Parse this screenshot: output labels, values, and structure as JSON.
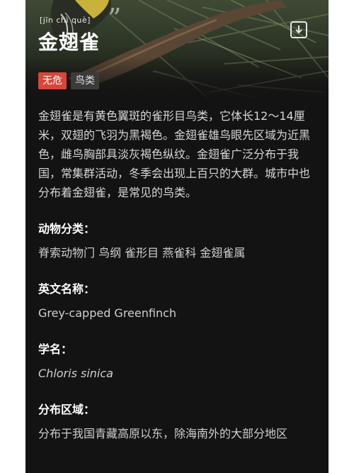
{
  "header": {
    "pinyin": "[jīn chì què]",
    "title": "金翅雀",
    "save_icon": "download-icon"
  },
  "tags": {
    "status": "无危",
    "category": "鸟类"
  },
  "description": "金翅雀是有黄色翼斑的雀形目鸟类，它体长12～14厘米，双翅的飞羽为黑褐色。金翅雀雄鸟眼先区域为近黑色，雌鸟胸部具淡灰褐色纵纹。金翅雀广泛分布于我国，常集群活动，冬季会出现上百只的大群。城市中也分布着金翅雀，是常见的鸟类。",
  "sections": [
    {
      "title": "动物分类：",
      "value": "脊索动物门 鸟纲 雀形目 燕雀科 金翅雀属"
    },
    {
      "title": "英文名称：",
      "value": "Grey-capped Greenfinch"
    },
    {
      "title": "学名：",
      "value": "Chloris sinica"
    },
    {
      "title": "分布区域：",
      "value": "分布于我国青藏高原以东，除海南外的大部分地区"
    }
  ],
  "colors": {
    "status_tag": "#d8463a",
    "background": "#131313"
  }
}
